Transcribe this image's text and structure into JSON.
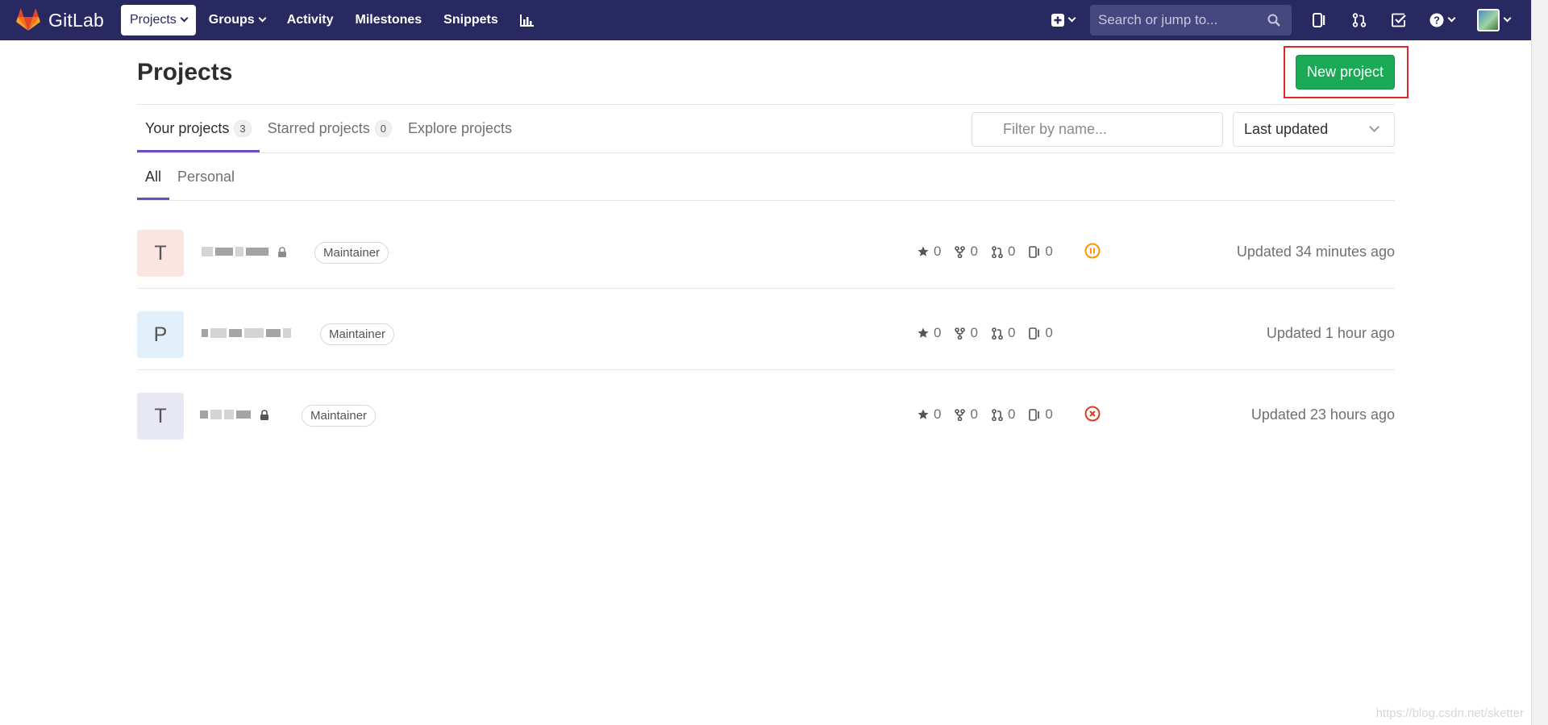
{
  "navbar": {
    "brand": "GitLab",
    "links": [
      {
        "label": "Projects",
        "dropdown": true,
        "active": true
      },
      {
        "label": "Groups",
        "dropdown": true,
        "active": false
      },
      {
        "label": "Activity",
        "dropdown": false,
        "active": false
      },
      {
        "label": "Milestones",
        "dropdown": false,
        "active": false
      },
      {
        "label": "Snippets",
        "dropdown": false,
        "active": false
      }
    ],
    "search_placeholder": "Search or jump to..."
  },
  "page": {
    "title": "Projects",
    "new_project_label": "New project"
  },
  "tabs": [
    {
      "label": "Your projects",
      "count": "3",
      "active": true
    },
    {
      "label": "Starred projects",
      "count": "0",
      "active": false
    },
    {
      "label": "Explore projects",
      "count": "",
      "active": false
    }
  ],
  "filter": {
    "placeholder": "Filter by name..."
  },
  "sort": {
    "selected": "Last updated"
  },
  "subtabs": [
    {
      "label": "All",
      "active": true
    },
    {
      "label": "Personal",
      "active": false
    }
  ],
  "projects": [
    {
      "initial": "T",
      "avatar_color": "#fbe5e1",
      "role": "Maintainer",
      "stars": "0",
      "forks": "0",
      "merge_requests": "0",
      "issues": "0",
      "status": "paused",
      "status_color": "#fc9403",
      "updated": "Updated 34 minutes ago"
    },
    {
      "initial": "P",
      "avatar_color": "#e1f0fb",
      "role": "Maintainer",
      "stars": "0",
      "forks": "0",
      "merge_requests": "0",
      "issues": "0",
      "status": "",
      "status_color": "",
      "updated": "Updated 1 hour ago"
    },
    {
      "initial": "T",
      "avatar_color": "#e8e8f4",
      "role": "Maintainer",
      "stars": "0",
      "forks": "0",
      "merge_requests": "0",
      "issues": "0",
      "status": "failed",
      "status_color": "#db3b21",
      "updated": "Updated 23 hours ago"
    }
  ],
  "colors": {
    "navbar": "#292961",
    "accent": "#6b4fbb",
    "new_project_button": "#1aaa55",
    "highlight_box": "#e5232a"
  },
  "watermark": "https://blog.csdn.net/sketter"
}
